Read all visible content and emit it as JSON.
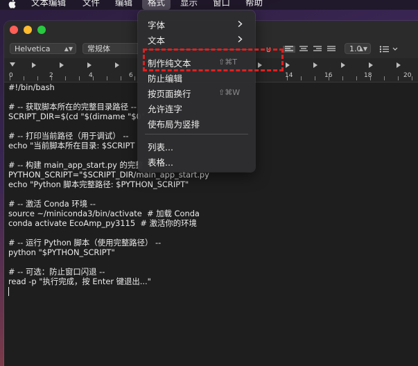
{
  "menubar": {
    "apple_icon": "apple-icon",
    "items": [
      "文本编辑",
      "文件",
      "编辑",
      "格式",
      "显示",
      "窗口",
      "帮助"
    ],
    "active": "格式"
  },
  "toolbar": {
    "font_family": "Helvetica",
    "font_style": "常规体",
    "line_spacing": "1.0"
  },
  "ruler": {
    "numbers": [
      "0",
      "2",
      "4",
      "6",
      "14",
      "16",
      "18",
      "20"
    ]
  },
  "editor": {
    "lines": [
      "#!/bin/bash",
      "",
      "# -- 获取脚本所在的完整目录路径 --",
      "SCRIPT_DIR=$(cd \"$(dirname \"$0\"",
      "",
      "# -- 打印当前路径（用于调试） --",
      "echo \"当前脚本所在目录: $SCRIPT",
      "",
      "# -- 构建 main_app_start.py 的完整",
      "PYTHON_SCRIPT=\"$SCRIPT_DIR/main_app_start.py",
      "echo \"Python 脚本完整路径: $PYTHON_SCRIPT\"",
      "",
      "# -- 激活 Conda 环境 --",
      "source ~/miniconda3/bin/activate  # 加载 Conda",
      "conda activate EcoAmp_py3115  # 激活你的环境",
      "",
      "# -- 运行 Python 脚本（使用完整路径） --",
      "python \"$PYTHON_SCRIPT\"",
      "",
      "# -- 可选：防止窗口闪退 --",
      "read -p \"执行完成，按 Enter 键退出...\""
    ]
  },
  "format_menu": {
    "font": "字体",
    "text": "文本",
    "make_plain_text": "制作纯文本",
    "make_plain_text_shortcut": "⇧⌘T",
    "prevent_editing": "防止编辑",
    "wrap_to_page": "按页面换行",
    "wrap_to_page_shortcut": "⇧⌘W",
    "allow_hyphenation": "允许连字",
    "vertical_layout": "使布局为竖排",
    "list": "列表...",
    "table": "表格..."
  },
  "colors": {
    "highlight_dashed_border": "#e02020",
    "close": "#ff5f57",
    "minimize": "#febc2e",
    "zoom": "#28c840"
  }
}
